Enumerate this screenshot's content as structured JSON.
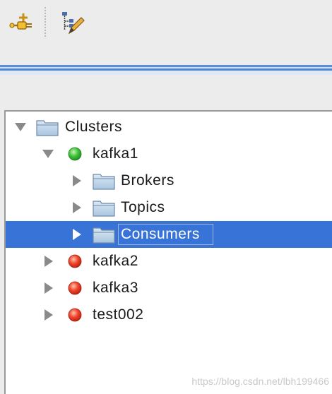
{
  "toolbar": {
    "buttons": [
      {
        "name": "add-cluster-button",
        "icon": "connection-plug-add-icon"
      },
      {
        "name": "edit-tree-button",
        "icon": "tree-edit-pencil-icon"
      }
    ]
  },
  "tree": {
    "nodes": [
      {
        "label": "Clusters",
        "icon": "folder-icon",
        "state": "expanded"
      },
      {
        "label": "kafka1",
        "icon": "status-green-icon",
        "state": "expanded"
      },
      {
        "label": "Brokers",
        "icon": "folder-icon",
        "state": "collapsed"
      },
      {
        "label": "Topics",
        "icon": "folder-icon",
        "state": "collapsed"
      },
      {
        "label": "Consumers",
        "icon": "folder-icon",
        "state": "collapsed",
        "selected": true
      },
      {
        "label": "kafka2",
        "icon": "status-red-icon",
        "state": "collapsed"
      },
      {
        "label": "kafka3",
        "icon": "status-red-icon",
        "state": "collapsed"
      },
      {
        "label": "test002",
        "icon": "status-red-icon",
        "state": "collapsed"
      }
    ]
  },
  "watermark": "https://blog.csdn.net/lbh199466",
  "colors": {
    "selection": "#3874d8",
    "accent": "#5b8fd8",
    "status_green": "#2fb52f",
    "status_red": "#e0321e",
    "folder": "#a9c6e0"
  }
}
